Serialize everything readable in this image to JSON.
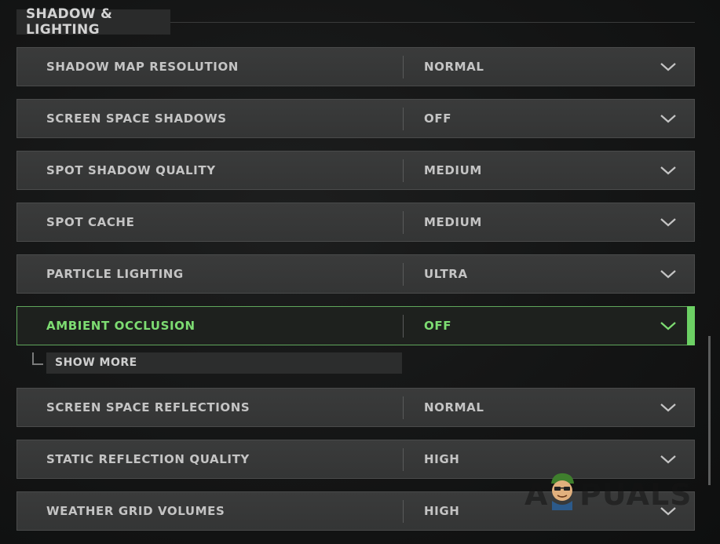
{
  "section": {
    "title": "SHADOW & LIGHTING"
  },
  "settings": [
    {
      "label": "SHADOW MAP RESOLUTION",
      "value": "NORMAL"
    },
    {
      "label": "SCREEN SPACE SHADOWS",
      "value": "OFF"
    },
    {
      "label": "SPOT SHADOW QUALITY",
      "value": "MEDIUM"
    },
    {
      "label": "SPOT CACHE",
      "value": "MEDIUM"
    },
    {
      "label": "PARTICLE LIGHTING",
      "value": "ULTRA"
    },
    {
      "label": "AMBIENT OCCLUSION",
      "value": "OFF",
      "active": true
    },
    {
      "label": "SCREEN SPACE REFLECTIONS",
      "value": "NORMAL"
    },
    {
      "label": "STATIC REFLECTION QUALITY",
      "value": "HIGH"
    },
    {
      "label": "WEATHER GRID VOLUMES",
      "value": "HIGH"
    }
  ],
  "show_more": {
    "label": "SHOW MORE"
  },
  "watermark": {
    "prefix": "A",
    "suffix": "PUALS"
  },
  "colors": {
    "background": "#141515",
    "row_background": "#383939",
    "text": "#c4c4c4",
    "active_accent": "#6cd064",
    "active_text": "#7ddc72"
  },
  "icons": {
    "dropdown": "chevron-down-icon",
    "watermark_mascot": "mascot-icon"
  }
}
